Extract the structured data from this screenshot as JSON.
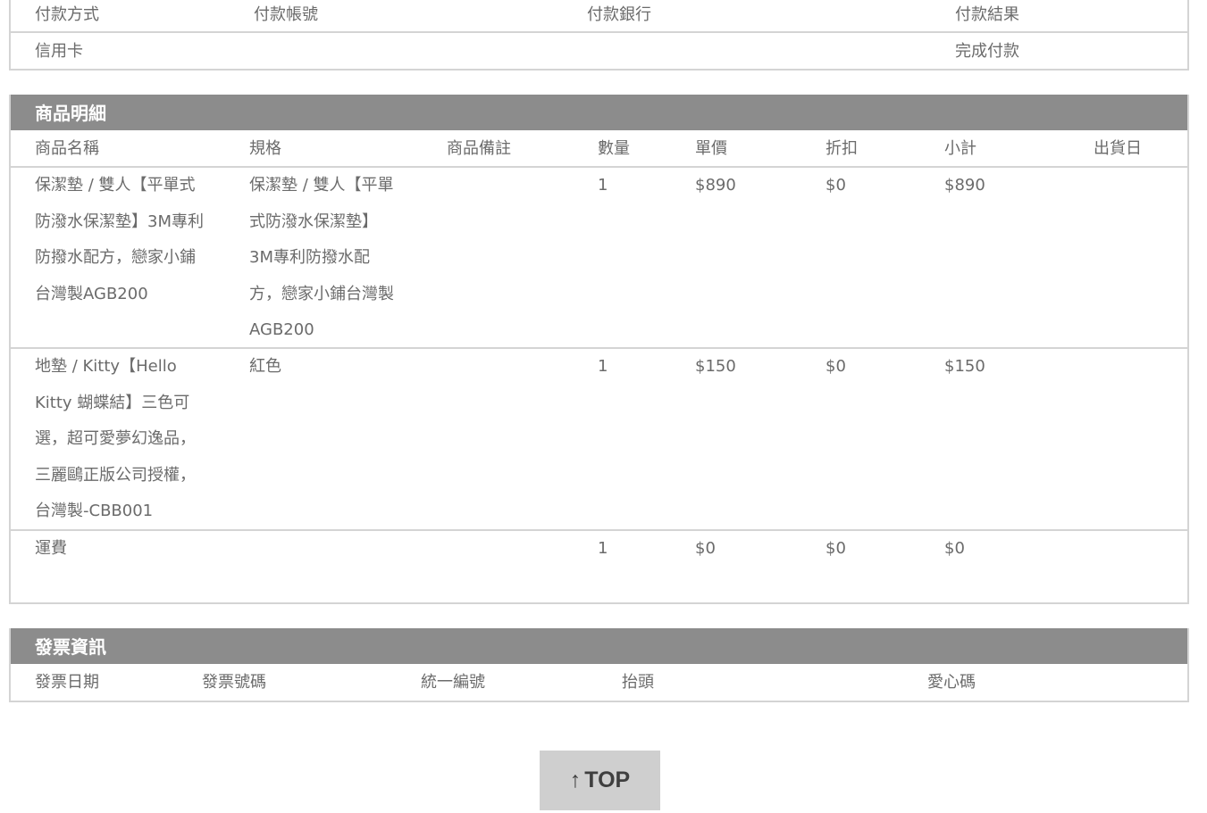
{
  "payment": {
    "headers": [
      "付款方式",
      "付款帳號",
      "付款銀行",
      "付款結果"
    ],
    "values": [
      "信用卡",
      "",
      "",
      "完成付款"
    ]
  },
  "products": {
    "title": "商品明細",
    "headers": [
      "商品名稱",
      "規格",
      "商品備註",
      "數量",
      "單價",
      "折扣",
      "小計",
      "出貨日"
    ],
    "items": [
      {
        "name_lines": [
          "保潔墊 / 雙人【平單式",
          "防潑水保潔墊】3M專利",
          "防撥水配方，戀家小鋪",
          "台灣製AGB200"
        ],
        "spec_lines": [
          "保潔墊 / 雙人【平單",
          "式防潑水保潔墊】",
          "3M專利防撥水配",
          "方，戀家小鋪台灣製",
          "AGB200"
        ],
        "note": "",
        "qty": "1",
        "price": "$890",
        "discount": "$0",
        "subtotal": "$890",
        "ship_date": ""
      },
      {
        "name_lines": [
          "地墊 / Kitty【Hello",
          "Kitty 蝴蝶結】三色可",
          "選，超可愛夢幻逸品，",
          "三麗鷗正版公司授權，",
          "台灣製-CBB001"
        ],
        "spec_lines": [
          "紅色"
        ],
        "note": "",
        "qty": "1",
        "price": "$150",
        "discount": "$0",
        "subtotal": "$150",
        "ship_date": ""
      },
      {
        "name_lines": [
          "運費"
        ],
        "spec_lines": [],
        "note": "",
        "qty": "1",
        "price": "$0",
        "discount": "$0",
        "subtotal": "$0",
        "ship_date": ""
      }
    ]
  },
  "invoice": {
    "title": "發票資訊",
    "headers": [
      "發票日期",
      "發票號碼",
      "統一編號",
      "抬頭",
      "愛心碼"
    ]
  },
  "top_button": {
    "arrow": "↑",
    "label": "TOP"
  },
  "colors": {
    "header_bg": "#8c8c8c",
    "border": "#d4d4d4",
    "text": "#6b6b6b",
    "button_bg": "#cfcfcf"
  }
}
